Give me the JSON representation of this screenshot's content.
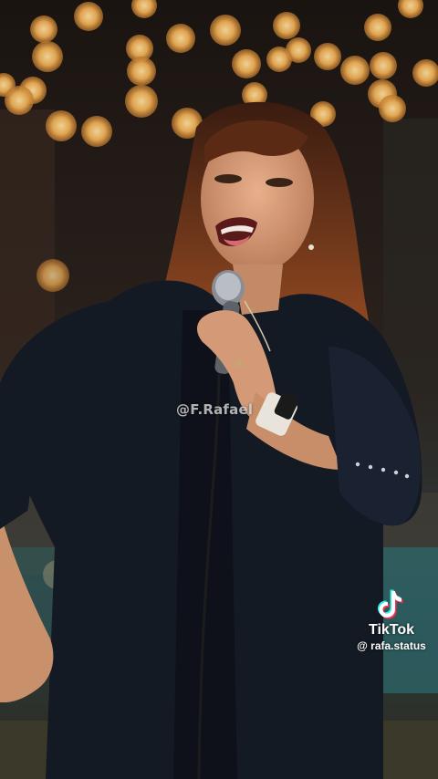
{
  "watermark": {
    "center_text": "@F.Rafael"
  },
  "tiktok": {
    "brand": "TikTok",
    "handle": "@ rafa.status"
  },
  "palette": {
    "bokeh": "#f3b257",
    "hair": "#7a3d1c",
    "clothing": "#141a24",
    "skin": "#d49a78"
  }
}
